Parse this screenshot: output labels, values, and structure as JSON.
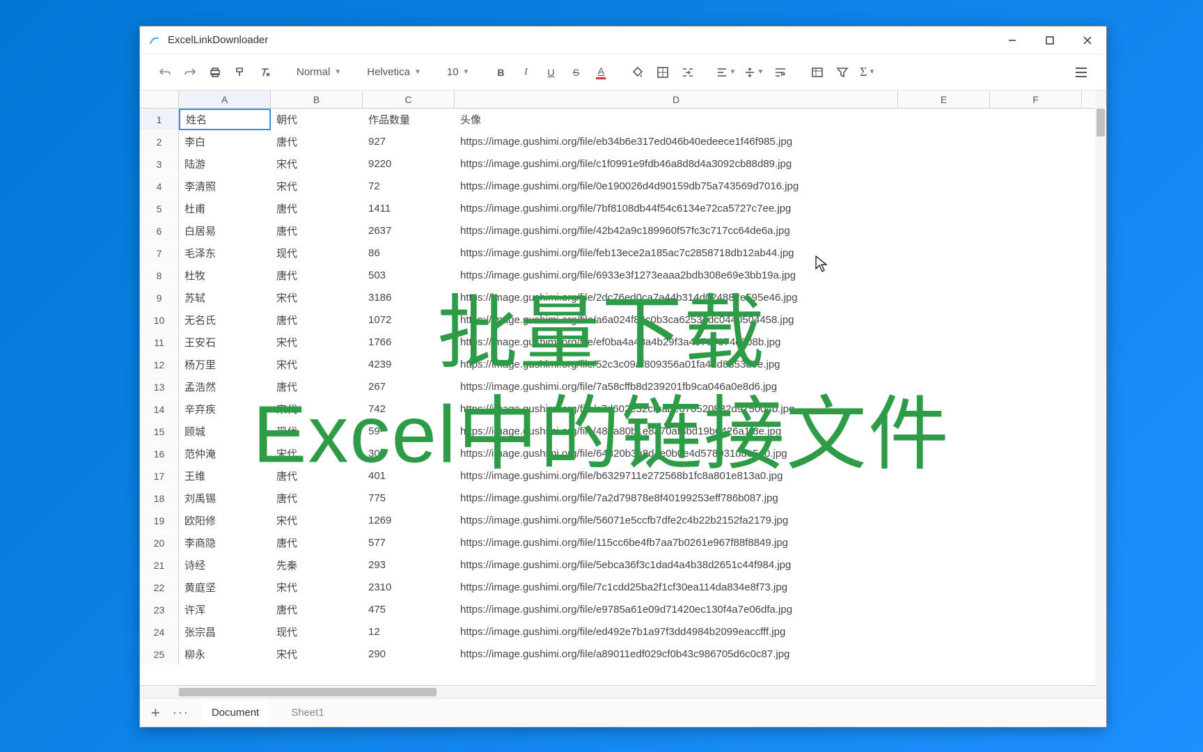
{
  "window": {
    "title": "ExcelLinkDownloader"
  },
  "toolbar": {
    "style_select": "Normal",
    "font_select": "Helvetica",
    "size_select": "10"
  },
  "columns": [
    "A",
    "B",
    "C",
    "D",
    "E",
    "F"
  ],
  "headers": {
    "A": "姓名",
    "B": "朝代",
    "C": "作品数量",
    "D": "头像"
  },
  "rows": [
    {
      "n": 1,
      "A": "姓名",
      "B": "朝代",
      "C": "作品数量",
      "D": "头像"
    },
    {
      "n": 2,
      "A": "李白",
      "B": "唐代",
      "C": "927",
      "D": "https://image.gushimi.org/file/eb34b6e317ed046b40edeece1f46f985.jpg"
    },
    {
      "n": 3,
      "A": "陆游",
      "B": "宋代",
      "C": "9220",
      "D": "https://image.gushimi.org/file/c1f0991e9fdb46a8d8d4a3092cb88d89.jpg"
    },
    {
      "n": 4,
      "A": "李清照",
      "B": "宋代",
      "C": "72",
      "D": "https://image.gushimi.org/file/0e190026d4d90159db75a743569d7016.jpg"
    },
    {
      "n": 5,
      "A": "杜甫",
      "B": "唐代",
      "C": "1411",
      "D": "https://image.gushimi.org/file/7bf8108db44f54c6134e72ca5727c7ee.jpg"
    },
    {
      "n": 6,
      "A": "白居易",
      "B": "唐代",
      "C": "2637",
      "D": "https://image.gushimi.org/file/42b42a9c189960f57fc3c717cc64de6a.jpg"
    },
    {
      "n": 7,
      "A": "毛泽东",
      "B": "现代",
      "C": "86",
      "D": "https://image.gushimi.org/file/feb13ece2a185ac7c2858718db12ab44.jpg"
    },
    {
      "n": 8,
      "A": "杜牧",
      "B": "唐代",
      "C": "503",
      "D": "https://image.gushimi.org/file/6933e3f1273eaaa2bdb308e69e3bb19a.jpg"
    },
    {
      "n": 9,
      "A": "苏轼",
      "B": "宋代",
      "C": "3186",
      "D": "https://image.gushimi.org/file/2dc76ed0ca7a44b314d024882e595e46.jpg"
    },
    {
      "n": 10,
      "A": "无名氏",
      "B": "唐代",
      "C": "1072",
      "D": "https://image.gushimi.org/file/a6a024f84c0b3ca62537dc0440504458.jpg"
    },
    {
      "n": 11,
      "A": "王安石",
      "B": "宋代",
      "C": "1766",
      "D": "https://image.gushimi.org/file/ef0ba4a48a4b29f3a40707074c608b.jpg"
    },
    {
      "n": 12,
      "A": "杨万里",
      "B": "宋代",
      "C": "4239",
      "D": "https://image.gushimi.org/file/52c3c09af809356a01fa41d8353d9e.jpg"
    },
    {
      "n": 13,
      "A": "孟浩然",
      "B": "唐代",
      "C": "267",
      "D": "https://image.gushimi.org/file/7a58cffb8d239201fb9ca046a0e8d6.jpg"
    },
    {
      "n": 14,
      "A": "辛弃疾",
      "B": "宋代",
      "C": "742",
      "D": "https://image.gushimi.org/file/c7d602e32cfbabe670520832d975004b.jpg"
    },
    {
      "n": 15,
      "A": "顾城",
      "B": "现代",
      "C": "59",
      "D": "https://image.gushimi.org/file/487a80b1e8a70af8bd19b6426a1f3e.jpg"
    },
    {
      "n": 16,
      "A": "范仲淹",
      "B": "宋代",
      "C": "300",
      "D": "https://image.gushimi.org/file/64820b3a8d4e0b0e4d578931dde5e0.jpg"
    },
    {
      "n": 17,
      "A": "王维",
      "B": "唐代",
      "C": "401",
      "D": "https://image.gushimi.org/file/b6329711e272568b1fc8a801e813a0.jpg"
    },
    {
      "n": 18,
      "A": "刘禹锡",
      "B": "唐代",
      "C": "775",
      "D": "https://image.gushimi.org/file/7a2d79878e8f40199253eff786b087.jpg"
    },
    {
      "n": 19,
      "A": "欧阳修",
      "B": "宋代",
      "C": "1269",
      "D": "https://image.gushimi.org/file/56071e5ccfb7dfe2c4b22b2152fa2179.jpg"
    },
    {
      "n": 20,
      "A": "李商隐",
      "B": "唐代",
      "C": "577",
      "D": "https://image.gushimi.org/file/115cc6be4fb7aa7b0261e967f88f8849.jpg"
    },
    {
      "n": 21,
      "A": "诗经",
      "B": "先秦",
      "C": "293",
      "D": "https://image.gushimi.org/file/5ebca36f3c1dad4a4b38d2651c44f984.jpg"
    },
    {
      "n": 22,
      "A": "黄庭坚",
      "B": "宋代",
      "C": "2310",
      "D": "https://image.gushimi.org/file/7c1cdd25ba2f1cf30ea114da834e8f73.jpg"
    },
    {
      "n": 23,
      "A": "许浑",
      "B": "唐代",
      "C": "475",
      "D": "https://image.gushimi.org/file/e9785a61e09d71420ec130f4a7e06dfa.jpg"
    },
    {
      "n": 24,
      "A": "张宗昌",
      "B": "现代",
      "C": "12",
      "D": "https://image.gushimi.org/file/ed492e7b1a97f3dd4984b2099eaccfff.jpg"
    },
    {
      "n": 25,
      "A": "柳永",
      "B": "宋代",
      "C": "290",
      "D": "https://image.gushimi.org/file/a89011edf029cf0b43c986705d6c0c87.jpg"
    }
  ],
  "tabs": {
    "add": "+",
    "more": "···",
    "active": "Document",
    "inactive": "Sheet1"
  },
  "overlay": {
    "line1": "批量下载",
    "line2": "Excel中的链接文件"
  },
  "selected_cell": "A1"
}
